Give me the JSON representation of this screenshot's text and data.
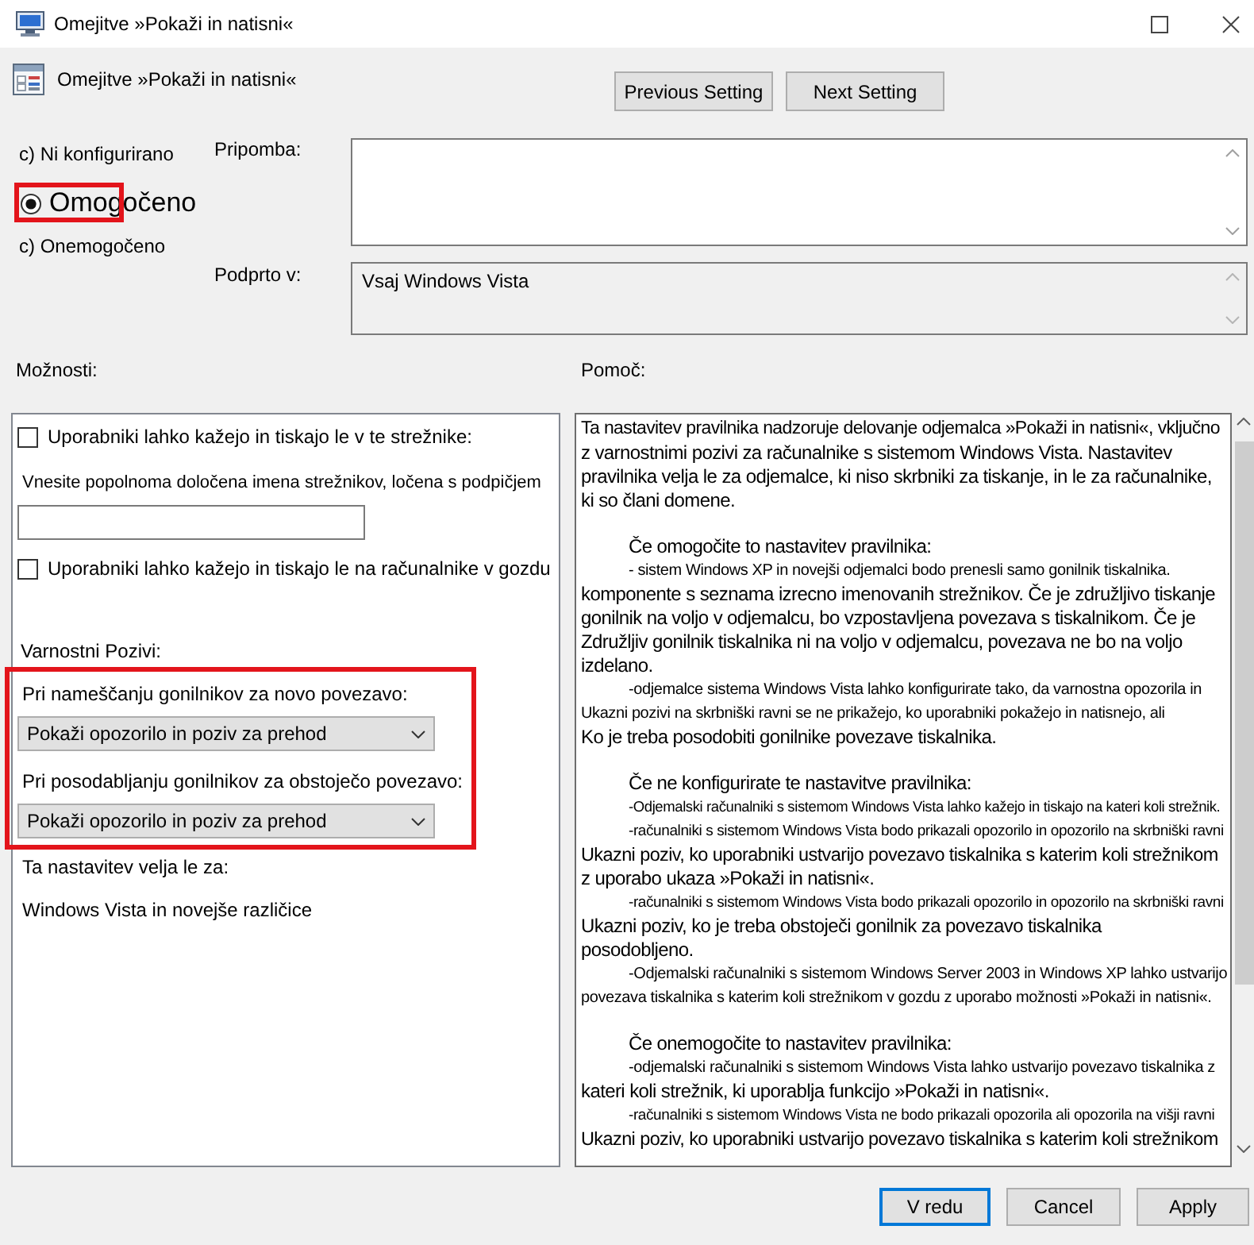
{
  "window": {
    "title": "Omejitve »Pokaži in natisni«"
  },
  "header": {
    "title": "Omejitve »Pokaži in natisni«",
    "buttons": [
      "Previous Setting",
      "Next Setting"
    ]
  },
  "state_options": [
    {
      "label": "c) Ni konfigurirano",
      "selected": false,
      "highlighted": false
    },
    {
      "label": "Omogočeno",
      "selected": true,
      "highlighted": true
    },
    {
      "label": "c) Onemogočeno",
      "selected": false,
      "highlighted": false
    }
  ],
  "comment": {
    "label": "Pripomba:"
  },
  "supported_on": {
    "label": "Podprto v:",
    "value": "Vsaj Windows Vista"
  },
  "options": {
    "label": "Možnosti:",
    "restrict_servers": {
      "label": "Uporabniki lahko kažejo in tiskajo le v te strežnike:",
      "checked": false
    },
    "server_names": {
      "label": "Vnesite popolnoma določena imena strežnikov, ločena s podpičjem"
    },
    "restrict_forest": {
      "label": "Uporabniki lahko kažejo in tiskajo le na računalnike v gozdu",
      "checked": false
    },
    "security_prompts": {
      "label": "Varnostni Pozivi:",
      "highlighted": true,
      "fields": [
        {
          "label": "Pri nameščanju gonilnikov za novo povezavo:",
          "value": "Pokaži opozorilo in poziv za prehod"
        },
        {
          "label": "Pri posodabljanju gonilnikov za obstoječo povezavo:",
          "value": "Pokaži opozorilo in poziv za prehod"
        }
      ]
    },
    "applies_to": {
      "label": "Ta nastavitev velja le za:",
      "value": "Windows Vista in novejše različice"
    }
  },
  "help": {
    "label": "Pomoč:",
    "paragraphs": [
      {
        "lines": [
          {
            "kind": "body",
            "text": "Ta nastavitev pravilnika nadzoruje delovanje odjemalca »Pokaži in natisni«, vključno"
          },
          {
            "kind": "body",
            "text": "z varnostnimi pozivi za računalnike s sistemom Windows Vista. Nastavitev"
          },
          {
            "kind": "body",
            "text": "pravilnika velja le za odjemalce, ki niso skrbniki za tiskanje, in le za računalnike,"
          },
          {
            "kind": "body",
            "text": "ki so člani domene."
          }
        ]
      },
      {
        "lines": [
          {
            "kind": "heading",
            "text": "Če omogočite to nastavitev pravilnika:"
          },
          {
            "kind": "note",
            "text": "- sistem Windows XP in novejši odjemalci bodo prenesli samo gonilnik tiskalnika."
          },
          {
            "kind": "body",
            "text": "komponente s seznama izrecno imenovanih strežnikov. Če je združljivo tiskanje"
          },
          {
            "kind": "body",
            "text": "gonilnik na voljo v odjemalcu, bo vzpostavljena povezava s tiskalnikom. Če je"
          },
          {
            "kind": "body",
            "text": "Združljiv gonilnik tiskalnika ni na voljo v odjemalcu, povezava ne bo na voljo"
          },
          {
            "kind": "body",
            "text": "izdelano."
          },
          {
            "kind": "note",
            "text": "-odjemalce sistema Windows Vista lahko konfigurirate tako, da varnostna opozorila in"
          },
          {
            "kind": "fine",
            "text": "Ukazni pozivi na skrbniški ravni se ne prikažejo, ko uporabniki pokažejo in natisnejo, ali"
          },
          {
            "kind": "body",
            "text": "Ko je treba posodobiti gonilnike povezave tiskalnika."
          }
        ]
      },
      {
        "lines": [
          {
            "kind": "heading",
            "text": "Če ne konfigurirate te nastavitve pravilnika:"
          },
          {
            "kind": "note",
            "text": "-Odjemalski računalniki s sistemom Windows Vista lahko kažejo in tiskajo na kateri koli strežnik."
          },
          {
            "kind": "note",
            "text": "-računalniki s sistemom Windows Vista bodo prikazali opozorilo in opozorilo na skrbniški ravni"
          },
          {
            "kind": "body",
            "text": "Ukazni poziv, ko uporabniki ustvarijo povezavo tiskalnika s katerim koli strežnikom"
          },
          {
            "kind": "body",
            "text": "z uporabo ukaza »Pokaži in natisni«."
          },
          {
            "kind": "note",
            "text": "-računalniki s sistemom Windows Vista bodo prikazali opozorilo in opozorilo na skrbniški ravni"
          },
          {
            "kind": "body",
            "text": "Ukazni poziv, ko je treba obstoječi gonilnik za povezavo tiskalnika"
          },
          {
            "kind": "body",
            "text": "posodobljeno."
          },
          {
            "kind": "note",
            "text": "-Odjemalski računalniki s sistemom Windows Server 2003 in Windows XP lahko ustvarijo"
          },
          {
            "kind": "fine",
            "text": "povezava tiskalnika s katerim koli strežnikom v gozdu z uporabo možnosti »Pokaži in natisni«."
          }
        ]
      },
      {
        "lines": [
          {
            "kind": "heading",
            "text": "Če onemogočite to nastavitev pravilnika:"
          },
          {
            "kind": "note",
            "text": "-odjemalski računalniki s sistemom Windows Vista lahko ustvarijo povezavo tiskalnika z"
          },
          {
            "kind": "body",
            "text": "kateri koli strežnik, ki uporablja funkcijo »Pokaži in natisni«."
          },
          {
            "kind": "note",
            "text": "-računalniki s sistemom Windows Vista ne bodo prikazali opozorila ali opozorila na višji ravni"
          },
          {
            "kind": "body",
            "text": "Ukazni poziv, ko uporabniki ustvarijo povezavo tiskalnika s katerim koli strežnikom"
          }
        ]
      }
    ]
  },
  "buttons": [
    {
      "label": "V redu",
      "default": true
    },
    {
      "label": "Cancel",
      "default": false
    },
    {
      "label": "Apply",
      "default": false
    }
  ]
}
